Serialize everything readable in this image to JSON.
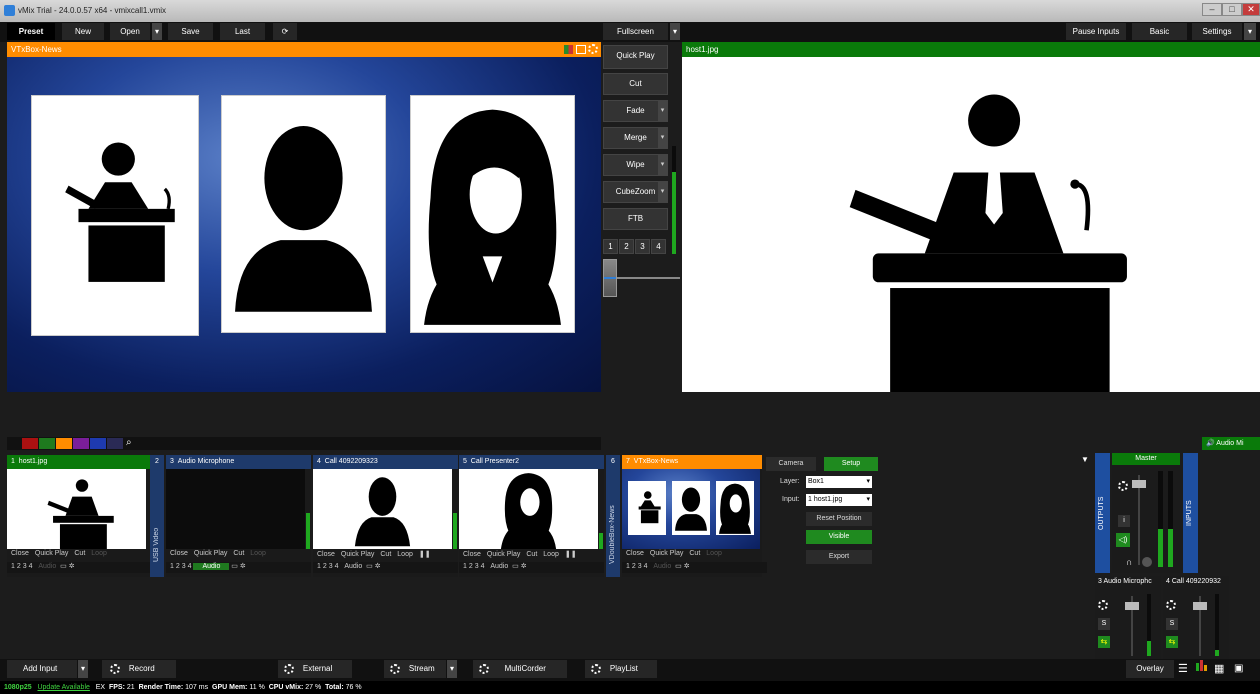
{
  "window": {
    "title": "vMix Trial - 24.0.0.57 x64 - vmixcall1.vmix"
  },
  "toolbar": {
    "preset": "Preset",
    "new": "New",
    "open": "Open",
    "save": "Save",
    "last": "Last",
    "fullscreen": "Fullscreen",
    "pause_inputs": "Pause Inputs",
    "basic": "Basic",
    "settings": "Settings"
  },
  "preview": {
    "title": "VTxBox-News"
  },
  "output": {
    "title": "host1.jpg"
  },
  "transitions": {
    "quick_play": "Quick Play",
    "cut": "Cut",
    "fade": "Fade",
    "merge": "Merge",
    "wipe": "Wipe",
    "cubezoom": "CubeZoom",
    "ftb": "FTB",
    "numbers": [
      "1",
      "2",
      "3",
      "4"
    ]
  },
  "inputs": [
    {
      "num": "1",
      "title": "host1.jpg",
      "head_color": "#0a7a0a"
    },
    {
      "num": "2",
      "title": "",
      "side_label": "USB Video"
    },
    {
      "num": "3",
      "title": "Audio Microphone",
      "head_color": "#1e3a6b"
    },
    {
      "num": "4",
      "title": "Call 4092209323",
      "head_color": "#1e3a6b"
    },
    {
      "num": "5",
      "title": "Call Presenter2",
      "head_color": "#1e3a6b"
    },
    {
      "num": "6",
      "title": "",
      "side_label": "VDoubleBox-News"
    },
    {
      "num": "7",
      "title": "VTxBox-News",
      "head_color": "#ff8c00"
    }
  ],
  "tile_buttons": {
    "close": "Close",
    "quick_play": "Quick Play",
    "cut": "Cut",
    "loop": "Loop",
    "n1": "1",
    "n2": "2",
    "n3": "3",
    "n4": "4",
    "audio": "Audio"
  },
  "layer_panel": {
    "camera": "Camera",
    "setup": "Setup",
    "layer_label": "Layer:",
    "layer_value": "Box1",
    "input_label": "Input:",
    "input_value": "1 host1.jpg",
    "reset_position": "Reset Position",
    "visible": "Visible",
    "export": "Export"
  },
  "audio_mixer": {
    "title": "Audio Mi",
    "master": "Master",
    "outputs": "OUTPUTS",
    "inputs": "INPUTS",
    "ch3": "3  Audio Microphc",
    "ch4": "4  Call 409220932",
    "s": "S",
    "i": "i"
  },
  "bottom": {
    "add_input": "Add Input",
    "record": "Record",
    "external": "External",
    "stream": "Stream",
    "multicorder": "MultiCorder",
    "playlist": "PlayList",
    "overlay": "Overlay"
  },
  "status": {
    "format": "1080p25",
    "update": "Update Available",
    "ex": "EX",
    "fps_label": "FPS:",
    "fps": "21",
    "render_label": "Render Time:",
    "render": "107 ms",
    "gpu_label": "GPU Mem:",
    "gpu": "11 %",
    "cpu_label": "CPU vMix:",
    "cpu": "27 %",
    "total_label": "Total:",
    "total": "76 %"
  },
  "colors": {
    "preview_orange": "#ff8c00",
    "program_green": "#0a7a0a",
    "input_blue": "#1e3a6b"
  }
}
